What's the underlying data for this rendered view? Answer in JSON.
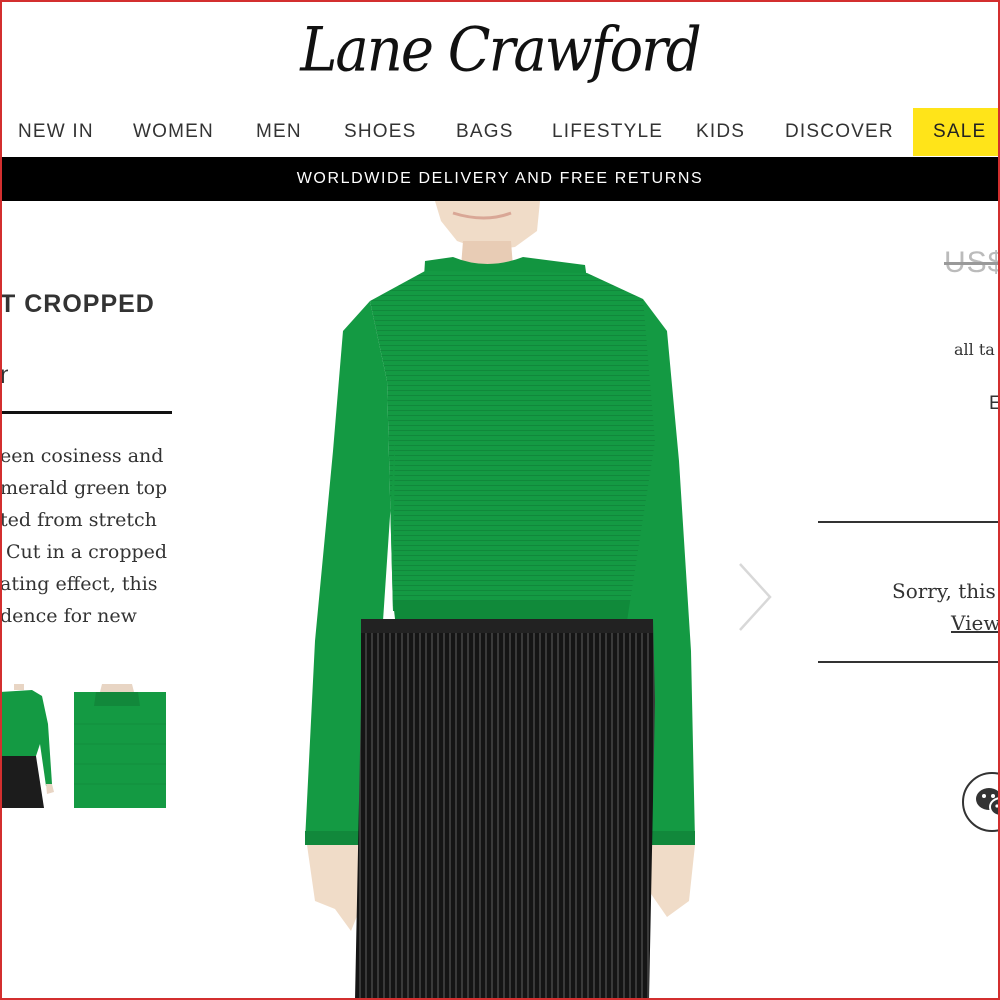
{
  "brand": {
    "name": "Lane Crawford"
  },
  "nav": {
    "items": [
      {
        "label": "NEW IN"
      },
      {
        "label": "WOMEN"
      },
      {
        "label": "MEN"
      },
      {
        "label": "SHOES"
      },
      {
        "label": "BAGS"
      },
      {
        "label": "LIFESTYLE"
      },
      {
        "label": "KIDS"
      },
      {
        "label": "DISCOVER"
      },
      {
        "label": "SALE"
      }
    ],
    "sale_highlight_color": "#ffe419"
  },
  "promo": {
    "text": "WORLDWIDE DELIVERY AND FREE RETURNS"
  },
  "product": {
    "title": "T CROPPED",
    "description_lines": [
      "een cosiness and",
      "merald green top",
      "ted from stretch",
      "Cut in a cropped",
      "ating effect, this",
      "dence for new"
    ],
    "primary_color": "#149a43"
  },
  "purchase": {
    "price": "US$",
    "tax_note": "all ta",
    "partial_label": "E",
    "availability": "Sorry, this",
    "view_link": "View"
  },
  "icons": {
    "next": "chevron-right-icon",
    "chat": "wechat-icon"
  }
}
